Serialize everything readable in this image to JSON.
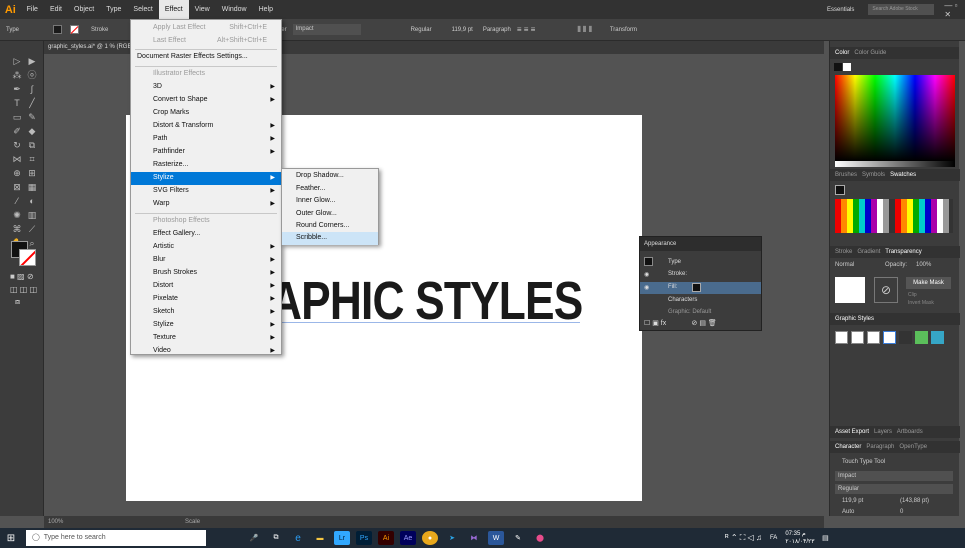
{
  "app": {
    "logo": "Ai"
  },
  "menubar": {
    "items": [
      "File",
      "Edit",
      "Object",
      "Type",
      "Select",
      "Effect",
      "View",
      "Window",
      "Help"
    ],
    "workspace": "Essentials",
    "search_placeholder": "Search Adobe Stock"
  },
  "controlbar": {
    "type_label": "Type",
    "stroke_label": "Stroke",
    "character_label": "Character",
    "font": "Impact",
    "style": "Regular",
    "size": "119,9 pt",
    "paragraph_label": "Paragraph",
    "transform_label": "Transform"
  },
  "document": {
    "tab_title": "graphic_styles.ai* @ 1 % (RGB/GPU Preview)",
    "zoom": "100%",
    "status": "Scale",
    "headline": "APHIC STYLES"
  },
  "effect_menu": {
    "apply_last": "Apply Last Effect",
    "apply_last_sc": "Shift+Ctrl+E",
    "last": "Last Effect",
    "last_sc": "Alt+Shift+Ctrl+E",
    "raster_settings": "Document Raster Effects Settings...",
    "illustrator_header": "Illustrator Effects",
    "illustrator_items": [
      "3D",
      "Convert to Shape",
      "Crop Marks",
      "Distort & Transform",
      "Path",
      "Pathfinder",
      "Rasterize...",
      "Stylize",
      "SVG Filters",
      "Warp"
    ],
    "photoshop_header": "Photoshop Effects",
    "photoshop_items": [
      "Effect Gallery...",
      "Artistic",
      "Blur",
      "Brush Strokes",
      "Distort",
      "Pixelate",
      "Sketch",
      "Stylize",
      "Texture",
      "Video"
    ]
  },
  "stylize_submenu": {
    "items": [
      "Drop Shadow...",
      "Feather...",
      "Inner Glow...",
      "Outer Glow...",
      "Round Corners...",
      "Scribble..."
    ]
  },
  "appearance_panel": {
    "title": "Appearance",
    "type": "Type",
    "stroke": "Stroke:",
    "fill": "Fill:",
    "characters": "Characters",
    "graphic": "Graphic: Default"
  },
  "right_panels": {
    "color_tabs": [
      "Color",
      "Color Guide"
    ],
    "swatch_tabs": [
      "Brushes",
      "Symbols",
      "Swatches"
    ],
    "transparency_tabs": [
      "Stroke",
      "Gradient",
      "Transparency"
    ],
    "blend_mode": "Normal",
    "opacity_label": "Opacity:",
    "opacity": "100%",
    "make_mask": "Make Mask",
    "clip": "Clip",
    "invert_mask": "Invert Mask",
    "graphic_styles": "Graphic Styles",
    "asset_tabs": [
      "Asset Export",
      "Layers",
      "Artboards"
    ],
    "char_tabs": [
      "Character",
      "Paragraph",
      "OpenType"
    ],
    "touch_type": "Touch Type Tool",
    "font": "Impact",
    "style": "Regular",
    "size": "119,9 pt",
    "leading": "(143,88 pt)",
    "tracking": "Auto",
    "kerning": "0"
  },
  "taskbar": {
    "search_placeholder": "Type here to search",
    "time": "07:35 م",
    "date": "۲۰۱۸/۰۴/۲۳",
    "lang": "FA"
  }
}
